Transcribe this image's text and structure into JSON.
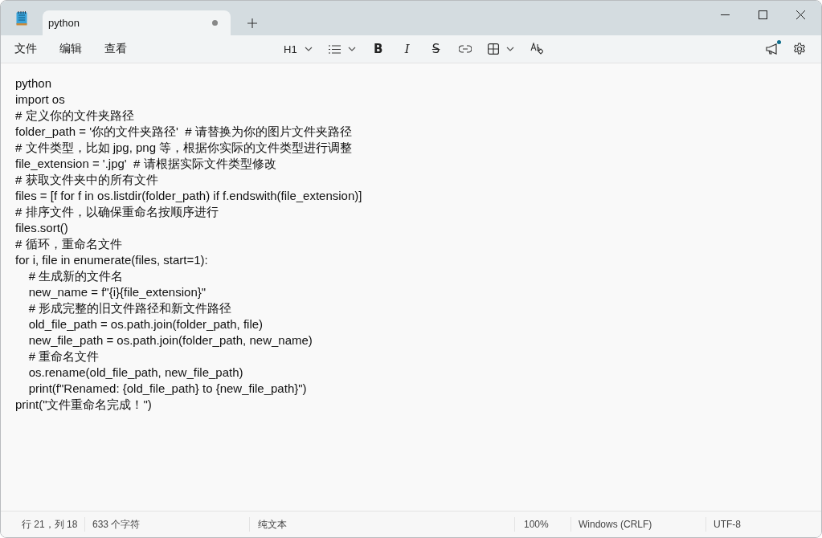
{
  "window": {
    "tab": {
      "title": "python",
      "unsaved": true,
      "selected": true
    }
  },
  "menu": [
    "文件",
    "编辑",
    "查看"
  ],
  "format_toolbar": [
    {
      "kind": "heading",
      "label": "H1"
    },
    {
      "kind": "list"
    },
    {
      "kind": "bold",
      "label": "B"
    },
    {
      "kind": "italic",
      "label": "I"
    },
    {
      "kind": "strike",
      "label": "S"
    },
    {
      "kind": "link"
    },
    {
      "kind": "table"
    },
    {
      "kind": "clear"
    }
  ],
  "whats_new": {
    "unread": true
  },
  "editor": {
    "lines": [
      "python",
      "import os",
      "# 定义你的文件夹路径",
      "folder_path = '你的文件夹路径'  # 请替换为你的图片文件夹路径",
      "# 文件类型，比如 jpg, png 等，根据你实际的文件类型进行调整",
      "file_extension = '.jpg'  # 请根据实际文件类型修改",
      "# 获取文件夹中的所有文件",
      "files = [f for f in os.listdir(folder_path) if f.endswith(file_extension)]",
      "# 排序文件，以确保重命名按顺序进行",
      "files.sort()",
      "# 循环，重命名文件",
      "for i, file in enumerate(files, start=1):",
      "    # 生成新的文件名",
      "    new_name = f\"{i}{file_extension}\"",
      "    # 形成完整的旧文件路径和新文件路径",
      "    old_file_path = os.path.join(folder_path, file)",
      "    new_file_path = os.path.join(folder_path, new_name)",
      "    # 重命名文件",
      "    os.rename(old_file_path, new_file_path)",
      "    print(f\"Renamed: {old_file_path} to {new_file_path}\")",
      "print(\"文件重命名完成！\")"
    ]
  },
  "status_bar": {
    "position": "行 21，列 18",
    "characters": "633 个字符",
    "format": "纯文本",
    "zoom": "100%",
    "line_ending": "Windows (CRLF)",
    "encoding": "UTF-8"
  }
}
